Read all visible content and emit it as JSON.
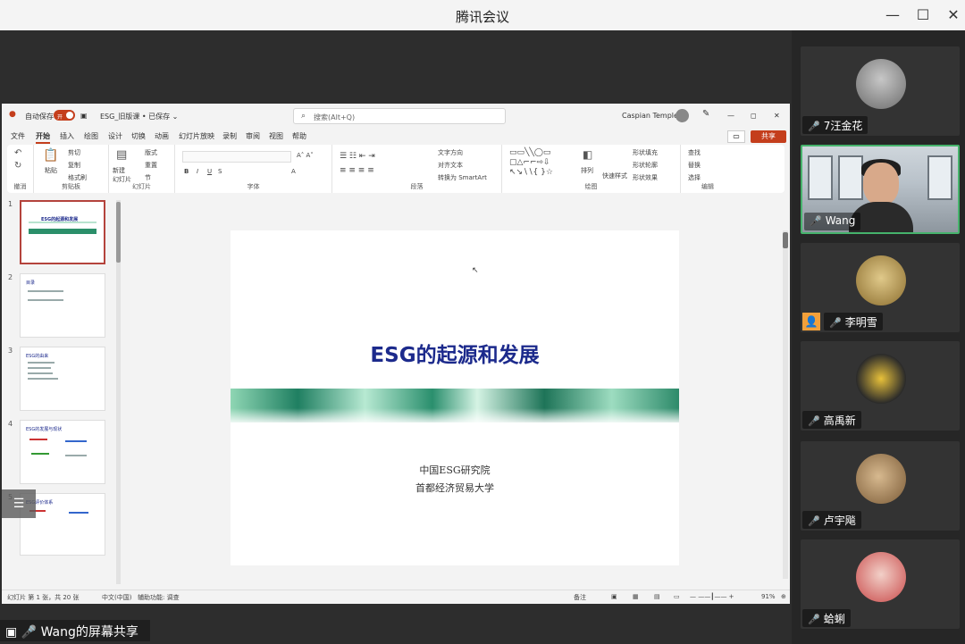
{
  "window": {
    "title": "腾讯会议",
    "minimize_icon": "—",
    "maximize_icon": "☐",
    "close_icon": "✕"
  },
  "ppt": {
    "autosave_label": "自动保存",
    "autosave_state": "开",
    "filename": "ESG_旧版课 • 已保存 ⌄",
    "search_placeholder": "搜索(Alt+Q)",
    "user_name": "Caspian Temple",
    "share_label": "共享",
    "tabs": [
      "文件",
      "开始",
      "插入",
      "绘图",
      "设计",
      "切换",
      "动画",
      "幻灯片放映",
      "录制",
      "审阅",
      "视图",
      "帮助"
    ],
    "ribbon": {
      "groups": [
        "撤消",
        "剪贴板",
        "幻灯片",
        "字体",
        "段落",
        "绘图",
        "编辑"
      ],
      "paste": "粘贴",
      "cut": "剪切",
      "copy": "复制",
      "format_painter": "格式刷",
      "new_slide": "新建\n幻灯片",
      "layout": "版式",
      "reset": "重置",
      "section": "节",
      "text_direction": "文字方向",
      "align_text": "对齐文本",
      "smartart": "转换为 SmartArt",
      "arrange": "排列",
      "quick_styles": "快速样式",
      "shape_fill": "形状填充",
      "shape_outline": "形状轮廓",
      "shape_effects": "形状效果",
      "find": "查找",
      "replace": "替换",
      "select": "选择"
    },
    "thumbnails": [
      {
        "num": "1",
        "title": "ESG的起源和发展"
      },
      {
        "num": "2",
        "title": "目录"
      },
      {
        "num": "3",
        "title": "ESG的由来"
      },
      {
        "num": "4",
        "title": "ESG的发展与现状"
      },
      {
        "num": "5",
        "title": "ESG评价体系"
      }
    ],
    "slide": {
      "title": "ESG的起源和发展",
      "line1": "中国ESG研究院",
      "line2": "首都经济贸易大学"
    },
    "status": {
      "slide_info": "幻灯片 第 1 张，共 20 张",
      "language": "中文(中国)",
      "accessibility": "辅助功能: 调查",
      "notes": "备注",
      "zoom": "91%"
    }
  },
  "presenter_label": "Wang的屏幕共享",
  "participants": [
    {
      "name": "7汪金花",
      "mic": "muted"
    },
    {
      "name": "Wang",
      "mic": "on"
    },
    {
      "name": "李明雪",
      "mic": "muted"
    },
    {
      "name": "高禹新",
      "mic": "muted"
    },
    {
      "name": "卢宇飚",
      "mic": "muted"
    },
    {
      "name": "蛤蜊",
      "mic": "muted"
    }
  ],
  "colors": {
    "accent_red": "#c43e1c",
    "slide_title_blue": "#1c2a8c",
    "active_speaker_green": "#46b36c",
    "muted_red": "#e24848"
  }
}
